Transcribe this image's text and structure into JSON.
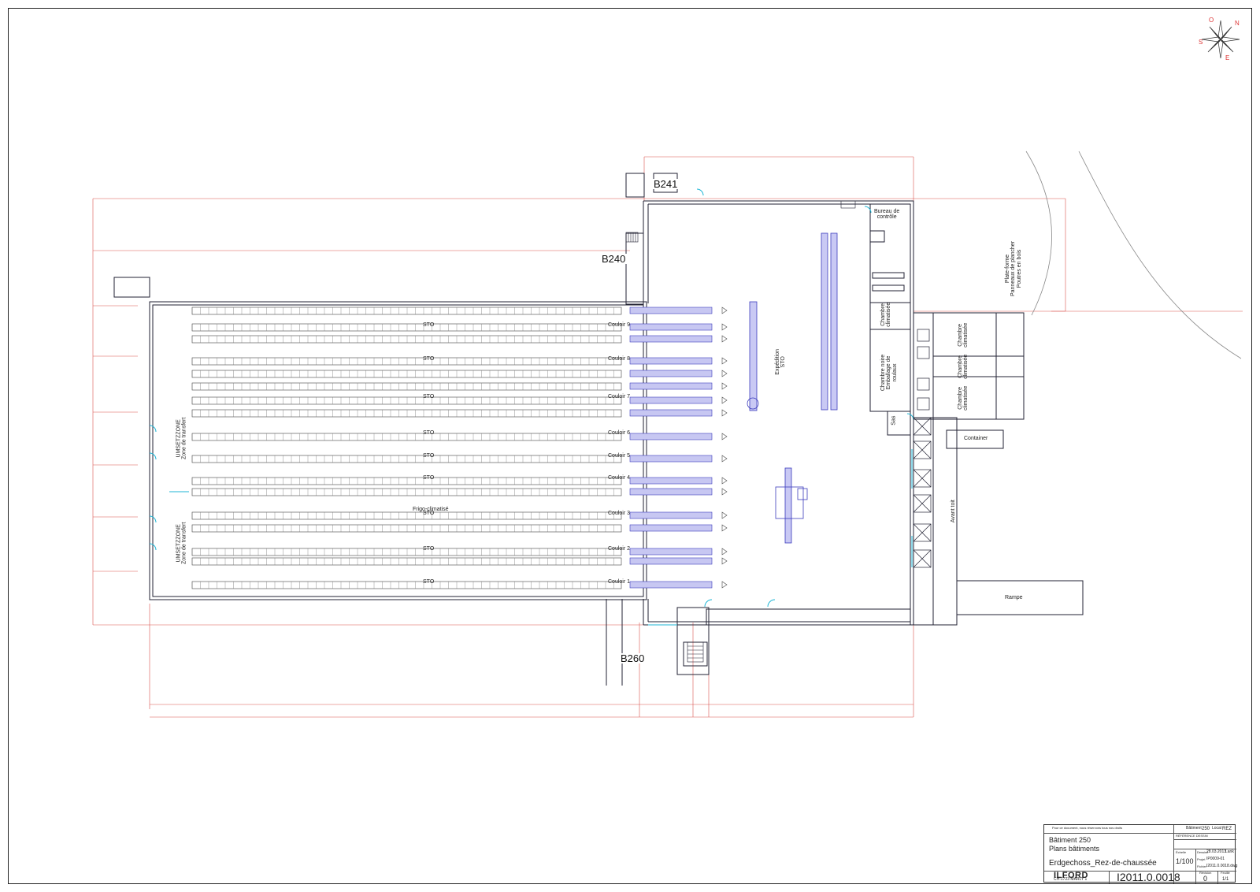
{
  "buildings": {
    "b241": "B241",
    "b240": "B240",
    "b260": "B260"
  },
  "rooms": {
    "bureau": "Bureau de\ncontrôle",
    "expedition": "Expédition\nSTO",
    "chambre_clim_1": "Chambre\nclimatisée",
    "chambre_noire": "Chambre noire\nEmballage de\nroulaux",
    "sas": "Sas",
    "chambre_clim_2": "Chambre\nclimatisée",
    "chambre_clim_3": "Chambre\nclimatisée",
    "chambre_clim_4": "Chambre\nclimatisée",
    "container": "Container",
    "avant_toit": "Avant toit",
    "rampe": "Rampe",
    "plateforme": "Plate-forme\nPanneaux de plancher\nPoutres en bois",
    "umsetz_1": "UMSETZZONE\nZone de transfert",
    "umsetz_2": "UMSETZZONE\nZone de transfert",
    "frigo": "Frigo-climatisé"
  },
  "aisles": [
    {
      "sto": "STO",
      "couloir": "Couloir 9"
    },
    {
      "sto": "STO",
      "couloir": "Couloir 8"
    },
    {
      "sto": "STO",
      "couloir": "Couloir 7"
    },
    {
      "sto": "STO",
      "couloir": "Couloir 6"
    },
    {
      "sto": "STO",
      "couloir": "Couloir 5"
    },
    {
      "sto": "STO",
      "couloir": "Couloir 4"
    },
    {
      "sto": "STO",
      "couloir": "Couloir 3"
    },
    {
      "sto": "STO",
      "couloir": "Couloir 2"
    },
    {
      "sto": "STO",
      "couloir": "Couloir 1"
    }
  ],
  "compass": {
    "n": "N",
    "e": "E",
    "s": "S",
    "o": "O"
  },
  "title_block": {
    "note": "Pour ce document, nous réservons tous nos droits",
    "batiment_label": "Bâtiment",
    "batiment_num": "250",
    "local_label": "Local",
    "local_value": "REZ",
    "reference": "RÉFÉRENCE DESSIN",
    "building": "Bâtiment 250",
    "plans": "Plans bâtiments",
    "sheet_title": "Erdgechoss_Rez-de-chaussée",
    "echelle_label": "Échelle",
    "scale": "1/100",
    "dessine_label": "Dessiné",
    "date": "28.03.2013",
    "author": "Lank",
    "projet_label": "Projet",
    "project": "IP0009-01",
    "file_label": "Fichier",
    "file": "I2011.0.0018.dwg",
    "company": "ILFORD",
    "address": "CH-1723 MARLY 1",
    "drawing_number": "I2011.0.0018",
    "revision_label": "Révision",
    "revision": "0",
    "page_label": "Feuille",
    "page": "1/1"
  }
}
